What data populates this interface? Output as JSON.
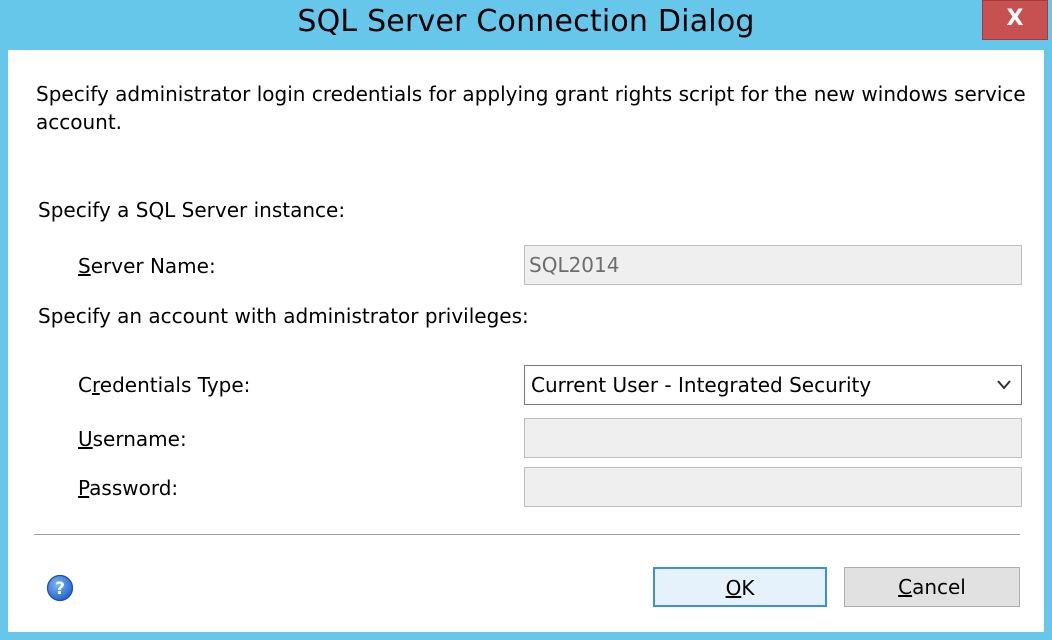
{
  "window": {
    "title": "SQL Server Connection Dialog",
    "close_label": "X"
  },
  "description": "Specify administrator login credentials for applying grant rights script for the new windows service account.",
  "instance_section": {
    "heading": "Specify a SQL Server instance:",
    "server_name_label_prefix": "",
    "server_name_label_mnemonic": "S",
    "server_name_label_rest": "erver Name:",
    "server_name_value": "SQL2014"
  },
  "account_section": {
    "heading": "Specify an account with administrator privileges:",
    "credentials_label_prefix": "C",
    "credentials_label_mnemonic": "r",
    "credentials_label_rest": "edentials Type:",
    "credentials_value": "Current User - Integrated Security",
    "username_label_mnemonic": "U",
    "username_label_rest": "sername:",
    "username_value": "",
    "password_label_mnemonic": "P",
    "password_label_rest": "assword:",
    "password_value": ""
  },
  "buttons": {
    "ok_mnemonic": "O",
    "ok_rest": "K",
    "cancel_mnemonic": "C",
    "cancel_rest": "ancel"
  },
  "icons": {
    "help": "help-icon",
    "dropdown": "chevron-down-icon"
  },
  "colors": {
    "title_bar": "#67c7ea",
    "close_button": "#c75050",
    "default_button_border": "#3c8fdc"
  }
}
